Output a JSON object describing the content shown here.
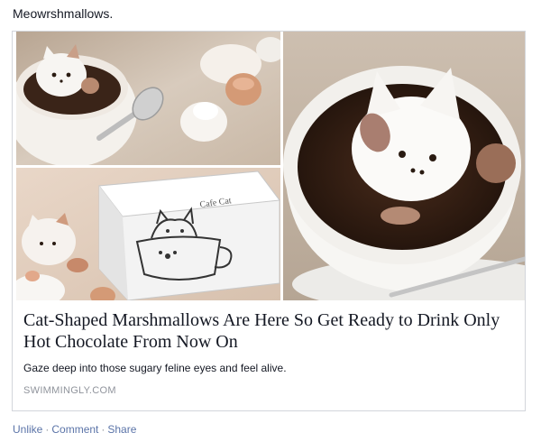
{
  "post": {
    "text": "Meowrshmallows."
  },
  "link_card": {
    "headline": "Cat-Shaped Marshmallows Are Here So Get Ready to Drink Only Hot Chocolate From Now On",
    "description": "Gaze deep into those sugary feline eyes and feel alive.",
    "domain": "SWIMMINGLY.COM",
    "box_label": "Cafe Cat"
  },
  "actions": {
    "unlike": "Unlike",
    "comment": "Comment",
    "share": "Share",
    "separator": "·"
  },
  "colors": {
    "link": "#5b74a8",
    "meta": "#90949c",
    "border": "#d3d6db",
    "text": "#141823"
  }
}
